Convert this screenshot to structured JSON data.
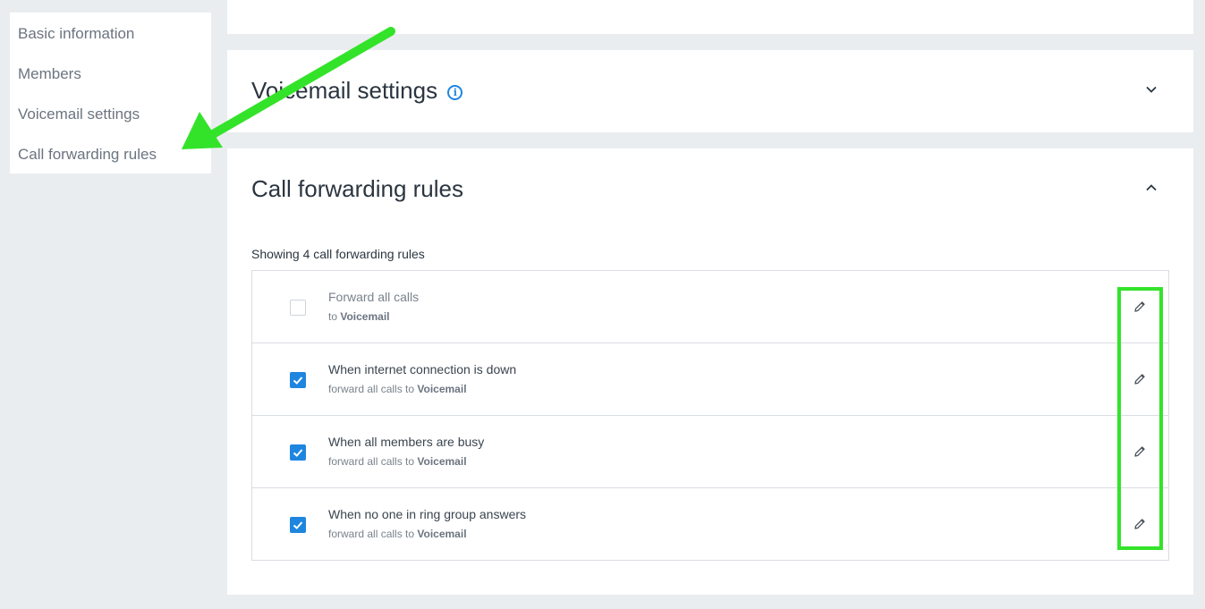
{
  "sidebar": {
    "items": [
      {
        "label": "Basic information"
      },
      {
        "label": "Members"
      },
      {
        "label": "Voicemail settings"
      },
      {
        "label": "Call forwarding rules"
      }
    ]
  },
  "voicemail_section": {
    "title": "Voicemail settings",
    "info_icon": "i",
    "expanded": false
  },
  "forwarding_section": {
    "title": "Call forwarding rules",
    "expanded": true,
    "count_text": "Showing 4 call forwarding rules",
    "rules": [
      {
        "title": "Forward all calls",
        "sub_prefix": "to",
        "target": "Voicemail",
        "checked": false
      },
      {
        "title": "When internet connection is down",
        "sub_prefix": "forward all calls to",
        "target": "Voicemail",
        "checked": true
      },
      {
        "title": "When all members are busy",
        "sub_prefix": "forward all calls to",
        "target": "Voicemail",
        "checked": true
      },
      {
        "title": "When no one in ring group answers",
        "sub_prefix": "forward all calls to",
        "target": "Voicemail",
        "checked": true
      }
    ]
  },
  "colors": {
    "accent": "#1f86e0",
    "annotation": "#33e32a",
    "background": "#eaedf0"
  },
  "icons": {
    "chevron_collapsed": "chevron-down-icon",
    "chevron_expanded": "chevron-up-icon",
    "edit": "pencil-icon",
    "info": "info-icon",
    "check": "checkmark-icon"
  }
}
